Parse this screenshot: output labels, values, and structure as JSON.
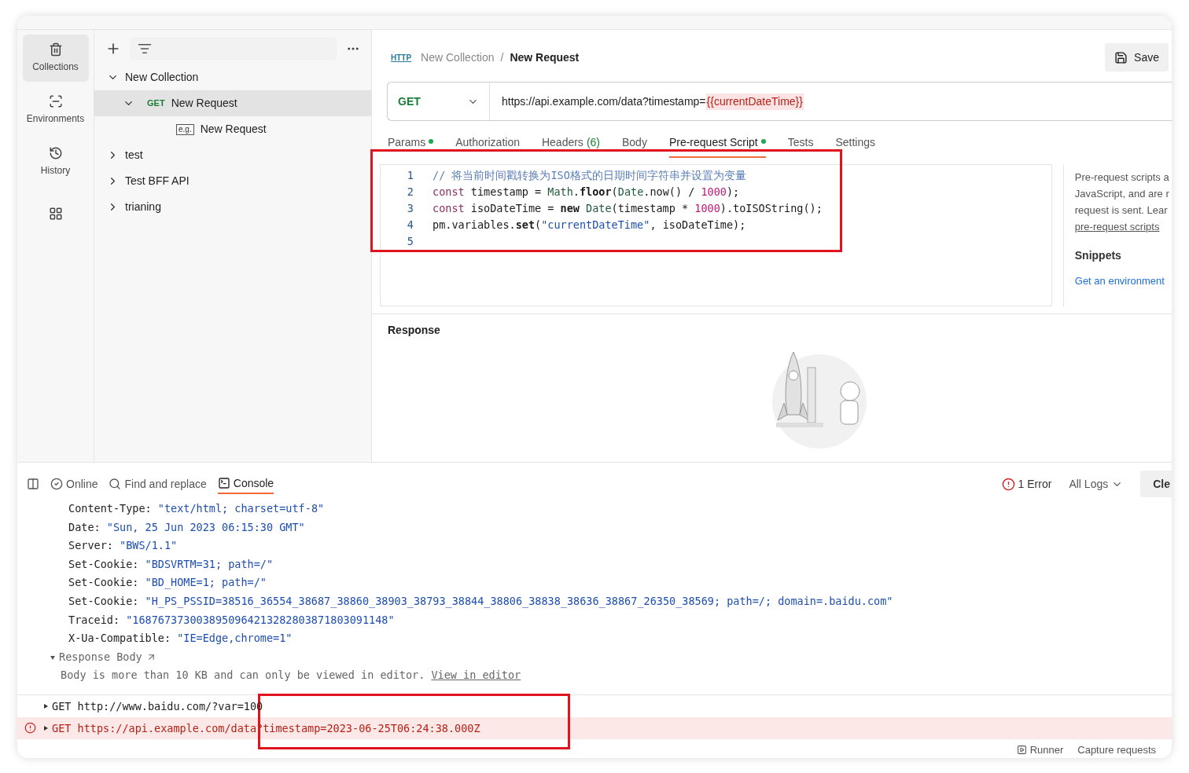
{
  "rail": [
    {
      "label": "Collections",
      "selected": true
    },
    {
      "label": "Environments",
      "selected": false
    },
    {
      "label": "History",
      "selected": false
    },
    {
      "selected": false
    }
  ],
  "tree": [
    {
      "label": "New Collection",
      "expanded": true,
      "children": [
        {
          "label": "New Request",
          "method": "GET",
          "expanded": true,
          "selected": true,
          "children": [
            {
              "label": "New Request",
              "badge": "e.g."
            }
          ]
        }
      ]
    },
    {
      "label": "test",
      "expanded": false
    },
    {
      "label": "Test BFF API",
      "expanded": false
    },
    {
      "label": "trianing",
      "expanded": false
    }
  ],
  "breadcrumb": {
    "badge": "HTTP",
    "collection": "New Collection",
    "separator": "/",
    "request": "New Request"
  },
  "save_button": "Save",
  "url_bar": {
    "method": "GET",
    "url": "https://api.example.com/data?timestamp=",
    "variable": "{{currentDateTime}}"
  },
  "request_tabs": [
    {
      "label": "Params",
      "dot": true,
      "selected": false
    },
    {
      "label": "Authorization",
      "dot": false,
      "selected": false
    },
    {
      "label": "Headers",
      "count": "(6)",
      "dot": false,
      "selected": false
    },
    {
      "label": "Body",
      "dot": false,
      "selected": false
    },
    {
      "label": "Pre-request Script",
      "dot": true,
      "selected": true
    },
    {
      "label": "Tests",
      "dot": false,
      "selected": false
    },
    {
      "label": "Settings",
      "dot": false,
      "selected": false
    }
  ],
  "code_lines": [
    {
      "number": "1",
      "tokens": [
        {
          "kind": "comment",
          "text": "// 将当前时间戳转换为ISO格式的日期时间字符串并设置为变量"
        }
      ]
    },
    {
      "number": "2",
      "tokens": [
        {
          "kind": "keyword",
          "text": "const"
        },
        {
          "kind": "plain",
          "text": " timestamp = "
        },
        {
          "kind": "type",
          "text": "Math"
        },
        {
          "kind": "plain",
          "text": "."
        },
        {
          "kind": "bold",
          "text": "floor"
        },
        {
          "kind": "plain",
          "text": "("
        },
        {
          "kind": "type",
          "text": "Date"
        },
        {
          "kind": "plain",
          "text": ".now() / "
        },
        {
          "kind": "number",
          "text": "1000"
        },
        {
          "kind": "plain",
          "text": ");"
        }
      ]
    },
    {
      "number": "3",
      "tokens": [
        {
          "kind": "keyword",
          "text": "const"
        },
        {
          "kind": "plain",
          "text": " isoDateTime = "
        },
        {
          "kind": "bold",
          "text": "new"
        },
        {
          "kind": "type",
          "text": " Date"
        },
        {
          "kind": "plain",
          "text": "(timestamp * "
        },
        {
          "kind": "number",
          "text": "1000"
        },
        {
          "kind": "plain",
          "text": ").toISOString();"
        }
      ]
    },
    {
      "number": "4",
      "tokens": [
        {
          "kind": "plain",
          "text": "pm.variables."
        },
        {
          "kind": "bold",
          "text": "set"
        },
        {
          "kind": "plain",
          "text": "("
        },
        {
          "kind": "string",
          "text": "\"currentDateTime\""
        },
        {
          "kind": "plain",
          "text": ", isoDateTime);"
        }
      ]
    },
    {
      "number": "5"
    }
  ],
  "help": {
    "lines": [
      "Pre-request scripts a",
      "JavaScript, and are r",
      "request is sent. Lear"
    ],
    "link": "pre-request scripts",
    "snippets_title": "Snippets",
    "snippets": [
      "Get an environment"
    ]
  },
  "response_title": "Response",
  "console_toolbar": {
    "online": "Online",
    "find": "Find and replace",
    "console": "Console",
    "errors": "1 Error",
    "filter": "All Logs",
    "clear": "Cle"
  },
  "headers": [
    {
      "key": "Content-Type:",
      "value": "\"text/html; charset=utf-8\""
    },
    {
      "key": "Date:",
      "value": "\"Sun, 25 Jun 2023 06:15:30 GMT\""
    },
    {
      "key": "Server:",
      "value": "\"BWS/1.1\""
    },
    {
      "key": "Set-Cookie:",
      "value": "\"BDSVRTM=31; path=/\""
    },
    {
      "key": "Set-Cookie:",
      "value": "\"BD_HOME=1; path=/\""
    },
    {
      "key": "Set-Cookie:",
      "value": "\"H_PS_PSSID=38516_36554_38687_38860_38903_38793_38844_38806_38838_38636_38867_26350_38569; path=/; domain=.baidu.com\""
    },
    {
      "key": "Traceid:",
      "value": "\"1687673730038950964213282803871803091148\""
    },
    {
      "key": "X-Ua-Compatible:",
      "value": "\"IE=Edge,chrome=1\""
    }
  ],
  "response_body": {
    "label": "Response Body",
    "expanded": true,
    "message": "Body is more than 10 KB and can only be viewed in editor.",
    "link": "View in editor"
  },
  "logs": [
    {
      "kind": "normal",
      "text": "GET http://www.baidu.com/?var=100"
    },
    {
      "kind": "error",
      "text": "GET https://api.example.com/data?timestamp=2023-06-25T06:24:38.000Z"
    }
  ],
  "footer": [
    "Runner",
    "Capture requests"
  ]
}
